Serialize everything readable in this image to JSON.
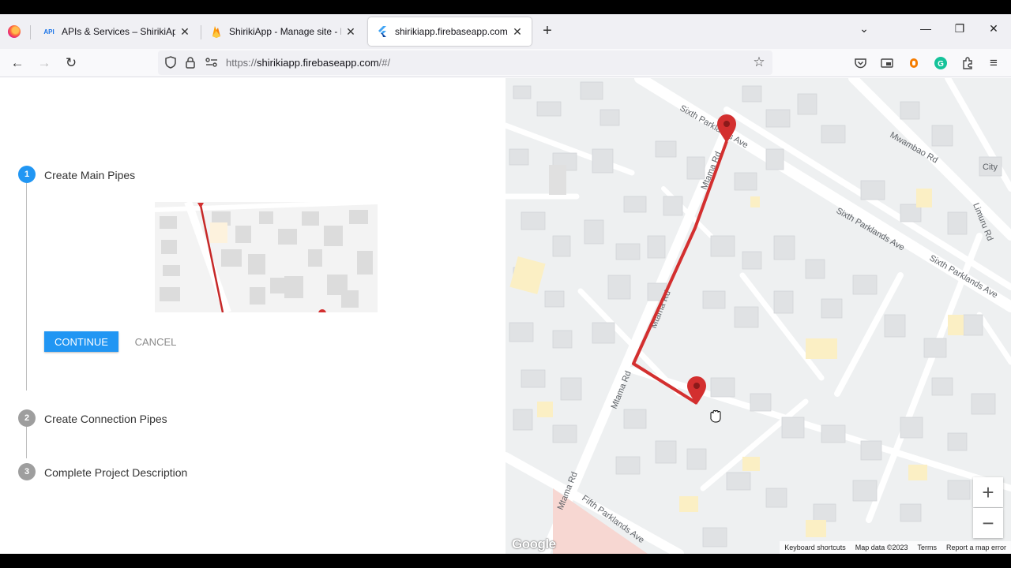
{
  "browser": {
    "tabs": [
      {
        "label": "APIs & Services – ShirikiApp – G",
        "favicon": "API"
      },
      {
        "label": "ShirikiApp - Manage site - Fireb",
        "favicon": "firebase-icon"
      },
      {
        "label": "shirikiapp.firebaseapp.com/#/",
        "favicon": "flutter-icon"
      }
    ],
    "url_prefix": "https://",
    "url_host": "shirikiapp.firebaseapp.com",
    "url_path": "/#/"
  },
  "stepper": {
    "steps": [
      {
        "number": "1",
        "label": "Create Main Pipes",
        "state": "active"
      },
      {
        "number": "2",
        "label": "Create Connection Pipes",
        "state": "inactive"
      },
      {
        "number": "3",
        "label": "Complete Project Description",
        "state": "inactive"
      }
    ],
    "continue_label": "CONTINUE",
    "cancel_label": "CANCEL",
    "active_color": "#2196f3",
    "inactive_color": "#9e9e9e"
  },
  "map": {
    "streets": [
      "Sixth Parklands Ave",
      "Mtama Rd",
      "Mwambao Rd",
      "Limuru Rd",
      "Fifth Parklands Ave",
      "City"
    ],
    "route_color": "#d32f2f",
    "zoom_in": "+",
    "zoom_out": "−",
    "logo": "Google",
    "footer": [
      "Keyboard shortcuts",
      "Map data ©2023",
      "Terms",
      "Report a map error"
    ]
  }
}
